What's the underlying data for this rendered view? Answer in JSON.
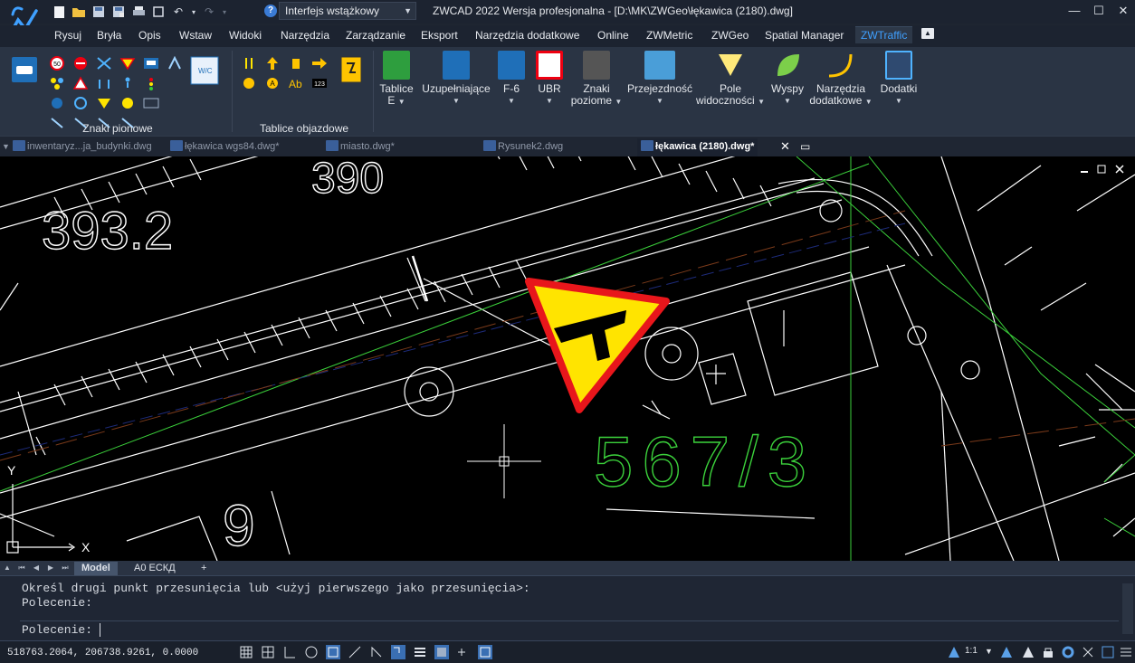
{
  "app": {
    "window_title": "ZWCAD 2022 Wersja profesjonalna - [D:\\MK\\ZWGeo\\łękawica (2180).dwg]",
    "workspace": "Interfejs wstążkowy"
  },
  "quick_access": [
    "new-icon",
    "open-icon",
    "save-icon",
    "save-as-icon",
    "print-icon",
    "fit-icon",
    "undo-icon",
    "redo-icon"
  ],
  "menu": [
    "Rysuj",
    "Bryła",
    "Opis",
    "Wstaw",
    "Widoki",
    "Narzędzia",
    "Zarządzanie",
    "Eksport",
    "Narzędzia dodatkowe",
    "Online",
    "ZWMetric",
    "ZWGeo",
    "Spatial Manager",
    "ZWTraffic"
  ],
  "menu_active": "ZWTraffic",
  "ribbon": {
    "panels": [
      "Znaki pionowe",
      "Tablice objazdowe"
    ],
    "buttons": [
      {
        "label1": "Tablice",
        "label2": "E"
      },
      {
        "label1": "Uzupełniające",
        "label2": ""
      },
      {
        "label1": "F-6",
        "label2": ""
      },
      {
        "label1": "UBR",
        "label2": ""
      },
      {
        "label1": "Znaki",
        "label2": "poziome"
      },
      {
        "label1": "Przejezdność",
        "label2": ""
      },
      {
        "label1": "Pole",
        "label2": "widoczności"
      },
      {
        "label1": "Wyspy",
        "label2": ""
      },
      {
        "label1": "Narzędzia",
        "label2": "dodatkowe"
      },
      {
        "label1": "Dodatki",
        "label2": ""
      }
    ]
  },
  "doc_tabs": [
    "inwentaryz...ja_budynki.dwg",
    "łękawica wgs84.dwg*",
    "miasto.dwg*",
    "Rysunek2.dwg",
    "łękawica (2180).dwg*"
  ],
  "active_doc": "łękawica (2180).dwg*",
  "drawing": {
    "text_393": "393.2",
    "text_390": "390",
    "text_parcel": "567/3",
    "text_9": "9",
    "ucs_x": "X",
    "ucs_y": "Y"
  },
  "layout_tabs": [
    "Model",
    "A0 ЕСКД",
    "+"
  ],
  "command": {
    "line1": "Określ drugi punkt przesunięcia lub <użyj pierwszego jako przesunięcia>:",
    "line2": "Polecenie:",
    "prompt": "Polecenie:"
  },
  "status": {
    "coords": "518763.2064, 206738.9261, 0.0000",
    "scale": "1:1"
  },
  "colors": {
    "accent": "#3fa0ff",
    "sign_yellow": "#ffe400",
    "sign_red": "#e8161b",
    "parcel_green": "#3bd13b"
  }
}
